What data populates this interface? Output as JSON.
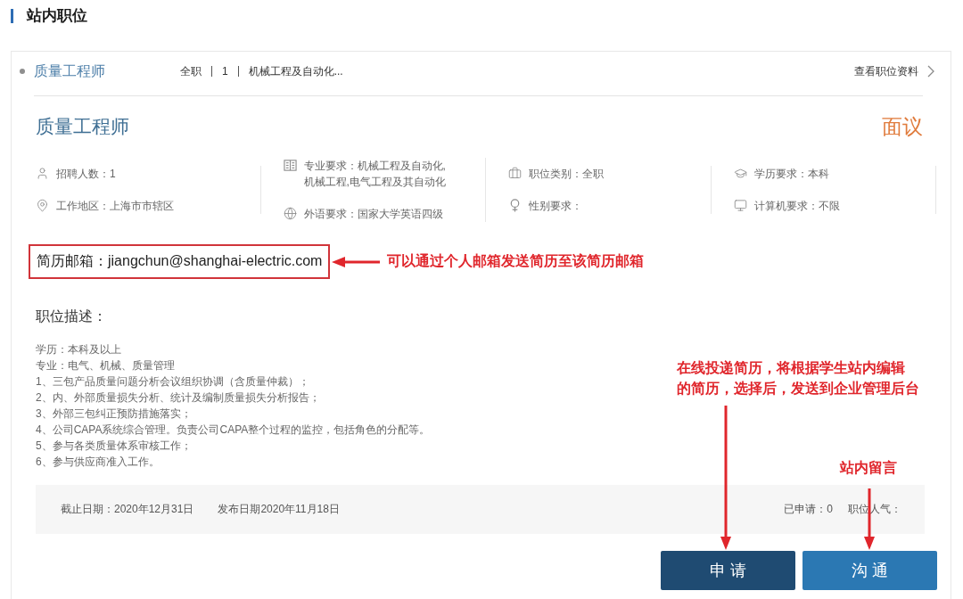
{
  "section_title": "站内职位",
  "job_summary": {
    "title": "质量工程师",
    "meta": [
      "全职",
      "1",
      "机械工程及自动化..."
    ],
    "detail_link": "查看职位资料"
  },
  "job_detail": {
    "title": "质量工程师",
    "salary": "面议",
    "info_columns": [
      [
        "招聘人数：1",
        "工作地区：上海市市辖区"
      ],
      [
        "专业要求：机械工程及自动化,机械工程,电气工程及其自动化",
        "外语要求：国家大学英语四级"
      ],
      [
        "职位类别：全职",
        "性别要求："
      ],
      [
        "学历要求：本科",
        "计算机要求：不限"
      ]
    ],
    "resume_email": {
      "text": "简历邮箱：jiangchun@shanghai-electric.com",
      "callout": "可以通过个人邮箱发送简历至该简历邮箱"
    },
    "description": {
      "heading": "职位描述：",
      "lines": [
        "学历：本科及以上",
        "专业：电气、机械、质量管理",
        "1、三包产品质量问题分析会议组织协调（含质量仲裁）；",
        "2、内、外部质量损失分析、统计及编制质量损失分析报告；",
        "3、外部三包纠正预防措施落实；",
        "4、公司CAPA系统综合管理。负责公司CAPA整个过程的监控，包括角色的分配等。",
        "5、参与各类质量体系审核工作；",
        "6、参与供应商准入工作。"
      ]
    },
    "footer": {
      "deadline": "截止日期：2020年12月31日",
      "published": "发布日期2020年11月18日",
      "applied": "已申请：0",
      "popularity": "职位人气："
    },
    "actions": [
      {
        "label": "申请",
        "kind": "primary",
        "callout": [
          "在线投递简历，将根据学生站内编辑",
          "的简历，选择后，发送到企业管理后台"
        ]
      },
      {
        "label": "沟通",
        "kind": "secondary",
        "callout": [
          "站内留言"
        ]
      }
    ]
  }
}
